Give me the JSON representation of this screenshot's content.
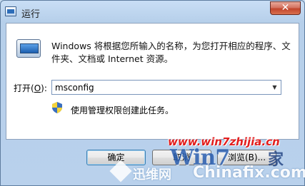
{
  "window": {
    "title": "运行",
    "close_label": "✕"
  },
  "dialog": {
    "description": "Windows 将根据您所输入的名称，为您打开相应的程序、文件夹、文档或 Internet 资源。",
    "open_label_prefix": "打开(",
    "open_label_hotkey": "O",
    "open_label_suffix": "):",
    "input_value": "msconfig",
    "admin_notice": "使用管理权限创建此任务。"
  },
  "buttons": {
    "ok": "确定",
    "cancel": "取消",
    "browse": "浏览(B)..."
  },
  "watermark": {
    "url": "www.win7zhijia.cn",
    "brand": "迅维网",
    "win7": "Win7",
    "jia": "家",
    "chinafix": "Chinafix.com"
  },
  "colors": {
    "accent": "#2d6db9",
    "watermark_red": "#e21e1e"
  },
  "icons": [
    "run-app-icon",
    "shield-icon",
    "chevron-down-icon",
    "close-icon"
  ]
}
